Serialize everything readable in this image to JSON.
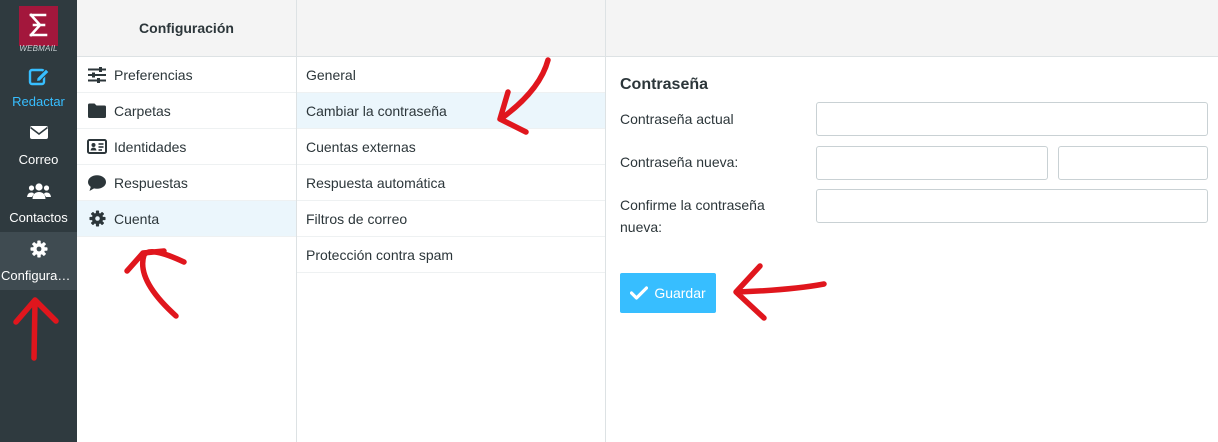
{
  "nav": {
    "logo_text": "WEBMAIL",
    "items": [
      {
        "label": "Redactar",
        "icon": "compose-icon"
      },
      {
        "label": "Correo",
        "icon": "envelope-icon"
      },
      {
        "label": "Contactos",
        "icon": "users-icon"
      },
      {
        "label": "Configuraci...",
        "icon": "gear-icon"
      }
    ]
  },
  "settings": {
    "title": "Configuración",
    "items": [
      {
        "label": "Preferencias",
        "icon": "sliders-icon"
      },
      {
        "label": "Carpetas",
        "icon": "folder-icon"
      },
      {
        "label": "Identidades",
        "icon": "id-card-icon"
      },
      {
        "label": "Respuestas",
        "icon": "comment-icon"
      },
      {
        "label": "Cuenta",
        "icon": "gear-icon"
      }
    ]
  },
  "account": {
    "items": [
      {
        "label": "General"
      },
      {
        "label": "Cambiar la contraseña"
      },
      {
        "label": "Cuentas externas"
      },
      {
        "label": "Respuesta automática"
      },
      {
        "label": "Filtros de correo"
      },
      {
        "label": "Protección contra spam"
      }
    ]
  },
  "password_form": {
    "title": "Contraseña",
    "current_label": "Contraseña actual",
    "new_label": "Contraseña nueva:",
    "confirm_label": "Confirme la contraseña nueva:",
    "current_value": "",
    "new_value": "",
    "new_repeat_value": "",
    "confirm_value": "",
    "save_label": "Guardar"
  },
  "colors": {
    "nav_bg": "#2f3a3f",
    "brand": "#a3173c",
    "accent": "#37beff",
    "selected_bg": "#ebf6fc",
    "annotation": "#e0161d"
  }
}
